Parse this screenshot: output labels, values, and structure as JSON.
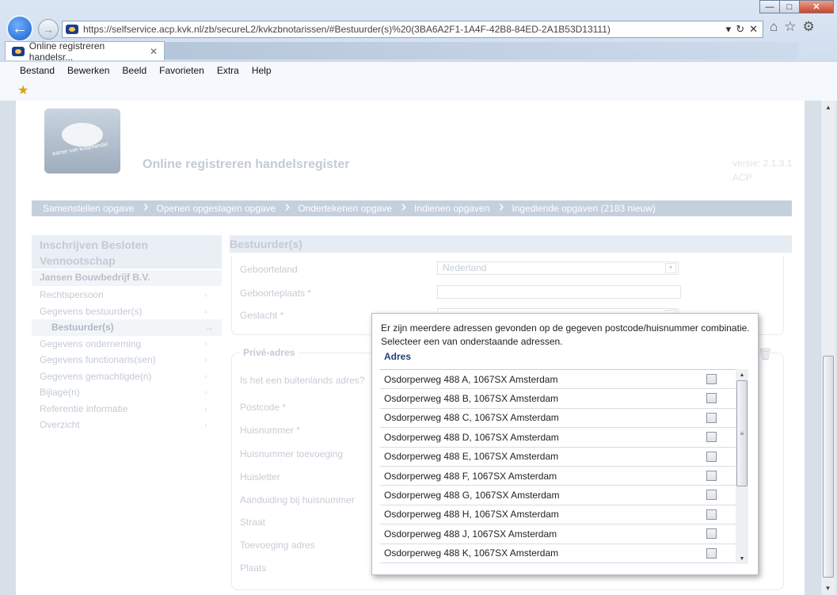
{
  "browser": {
    "url": "https://selfservice.acp.kvk.nl/zb/secureL2/kvkzbnotarissen/#Bestuurder(s)%20(3BA6A2F1-1A4F-42B8-84ED-2A1B53D13111)",
    "active_tab": "Online registreren handelsr...",
    "menu": [
      "Bestand",
      "Bewerken",
      "Beeld",
      "Favorieten",
      "Extra",
      "Help"
    ]
  },
  "header": {
    "logo_text": "kamer van koophandel",
    "app_title": "Online registreren handelsregister",
    "version": [
      "versie: 2.1.3.1",
      "ACP"
    ]
  },
  "wizard": {
    "steps": [
      "Samenstellen opgave",
      "Openen opgeslagen opgave",
      "Ondertekenen opgave",
      "Indienen opgaven",
      "Ingediende opgaven (2183 nieuw)"
    ]
  },
  "sidebar": {
    "title": "Inschrijven Besloten Vennootschap",
    "company": "Jansen Bouwbedrijf B.V.",
    "items": [
      {
        "label": "Rechtspersoon",
        "sub": false
      },
      {
        "label": "Gegevens bestuurder(s)",
        "sub": false
      },
      {
        "label": "Bestuurder(s)",
        "sub": true
      },
      {
        "label": "Gegevens onderneming",
        "sub": false
      },
      {
        "label": "Gegevens functionaris(sen)",
        "sub": false
      },
      {
        "label": "Gegevens gemachtigde(n)",
        "sub": false
      },
      {
        "label": "Bijlage(n)",
        "sub": false
      },
      {
        "label": "Referentie informatie",
        "sub": false
      },
      {
        "label": "Overzicht",
        "sub": false
      }
    ]
  },
  "form": {
    "section_title": "Bestuurder(s)",
    "geboorteland_label": "Geboorteland",
    "geboorteland_value": "Nederland",
    "geboorteplaats_label": "Geboorteplaats *",
    "geslacht_label": "Geslacht *",
    "prive_legend": "Privé-adres",
    "prive_fields": [
      "Is het een buitenlands adres?",
      "Postcode *",
      "Huisnummer *",
      "Huisnummer toevoeging",
      "Huisletter",
      "Aanduiding bij huisnummer",
      "Straat",
      "Toevoeging adres",
      "Plaats"
    ]
  },
  "modal": {
    "message": "Er zijn meerdere adressen gevonden op de gegeven postcode/huisnummer combinatie. Selecteer een van onderstaande adressen.",
    "column_header": "Adres",
    "addresses": [
      "Osdorperweg 488 A, 1067SX Amsterdam",
      "Osdorperweg 488 B, 1067SX Amsterdam",
      "Osdorperweg 488 C, 1067SX Amsterdam",
      "Osdorperweg 488 D, 1067SX Amsterdam",
      "Osdorperweg 488 E, 1067SX Amsterdam",
      "Osdorperweg 488 F, 1067SX Amsterdam",
      "Osdorperweg 488 G, 1067SX Amsterdam",
      "Osdorperweg 488 H, 1067SX Amsterdam",
      "Osdorperweg 488 J, 1067SX Amsterdam",
      "Osdorperweg 488 K, 1067SX Amsterdam"
    ]
  }
}
